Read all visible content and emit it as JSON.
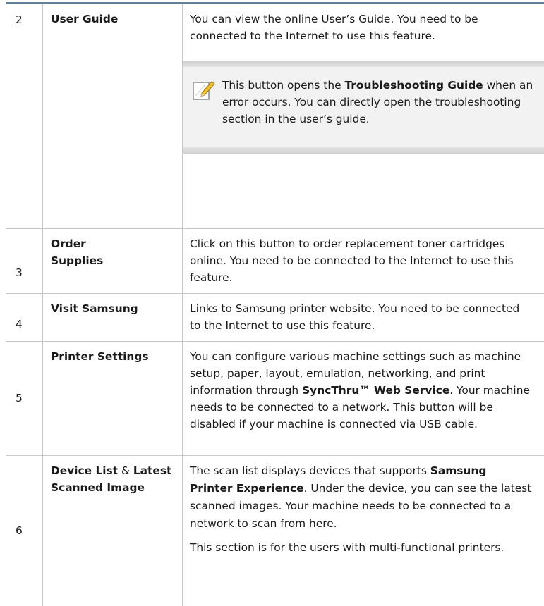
{
  "rows": [
    {
      "number": "2",
      "name": "User Guide",
      "desc": "You can view the online User’s Guide. You need to be connected to the Internet to use this feature.",
      "note": {
        "before": "This button opens the ",
        "term": "Troubleshooting Guide",
        "after": " when an error occurs. You can directly open the troubleshooting section in the user’s guide."
      }
    },
    {
      "number": "3",
      "name_line1": "Order",
      "name_line2": "Supplies",
      "desc": "Click on this button to order replacement toner cartridges online. You need to be connected to the Internet to use this feature."
    },
    {
      "number": "4",
      "name": "Visit Samsung",
      "desc": "Links to Samsung printer website. You need to be connected to the Internet to use this feature."
    },
    {
      "number": "5",
      "name": "Printer Settings",
      "desc_before": "You can configure various machine settings such as machine setup, paper, layout, emulation, networking, and print information through ",
      "desc_term": "SyncThru™ Web Service",
      "desc_after": ". Your machine needs to be connected to a network. This button will be disabled if your machine is connected via USB cable."
    },
    {
      "number": "6",
      "name_part1": "Device List",
      "name_amp": " & ",
      "name_part2": "Latest Scanned Image",
      "desc_before": "The scan list displays devices that supports ",
      "desc_term": "Samsung Printer Experience",
      "desc_after": ". Under the device, you can see the latest scanned images. Your machine needs to be connected to a network to scan from here.",
      "desc2": "This section is for the users with multi-functional printers."
    }
  ],
  "icons": {
    "note": "note-pencil-icon"
  }
}
